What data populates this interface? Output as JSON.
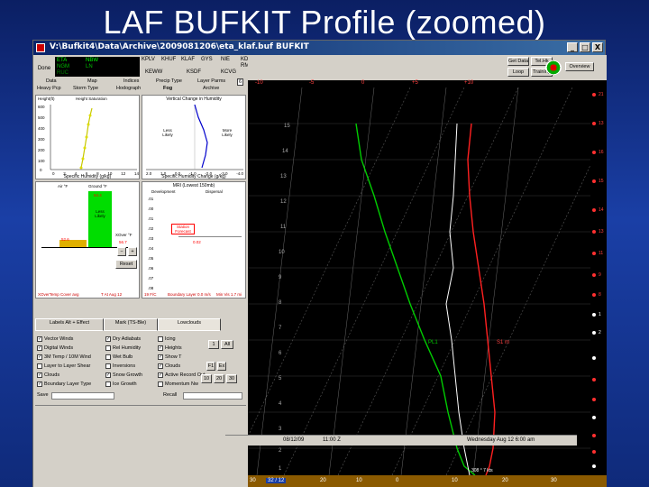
{
  "slide": {
    "title": "LAF BUFKIT Profile (zoomed)"
  },
  "window": {
    "title": "V:\\Bufkit4\\Data\\Archive\\2009081206\\eta_klaf.buf  BUFKIT",
    "buttons": [
      "_",
      "□",
      "X"
    ]
  },
  "model_panel": {
    "label": "Done",
    "models": [
      {
        "name": "ETA",
        "tag": "NBW"
      },
      {
        "name": "NGM",
        "tag": "LN"
      },
      {
        "name": "RUC",
        "tag": ""
      }
    ]
  },
  "stations": {
    "row1": [
      "KPLV",
      "KHUF",
      "KLAF",
      "GYS",
      "NIE",
      "KDAY"
    ],
    "row2": [
      "KEWW",
      "KSDF",
      "KCVG",
      "RMUN"
    ]
  },
  "menu": {
    "row1": [
      "Data",
      "Map",
      "Indices",
      "Precip Type",
      "Layer Parms"
    ],
    "row2": [
      "Heavy Pcp",
      "Storm Type",
      "Hodograph",
      "Fog",
      "Archive"
    ],
    "selected": "Fog",
    "page_number": "6"
  },
  "right_buttons": {
    "row1": [
      "Get Data",
      "Tel.Hk"
    ],
    "row2": [
      "Loop",
      "Training"
    ],
    "overview": "Overview"
  },
  "temp_axis": {
    "labels": [
      "-10",
      "-5",
      "0",
      "+5",
      "+10"
    ],
    "right_labels": [
      "21",
      "13",
      "16",
      "15",
      "14",
      "13",
      "11",
      "9",
      "8",
      "1",
      "2"
    ]
  },
  "panel_humidity": {
    "title": "Height  Saturation",
    "ylabel_top": "Height(ft)",
    "y_ticks": [
      "600",
      "500",
      "400",
      "300",
      "200",
      "100",
      "0"
    ],
    "x_ticks": [
      "0",
      "2",
      "4",
      "6",
      "8",
      "10",
      "12",
      "14"
    ],
    "xlabel": "Specific Humidity (g/kg)"
  },
  "panel_change": {
    "title": "Vertical Change in Humidity",
    "left_text": "Less Likely",
    "right_text": "More Likely",
    "x_ticks": [
      "2.0",
      "1.0",
      "0.0",
      "-1.0",
      "-2.0",
      "-3.0",
      "-4.0"
    ],
    "xlabel": "Specific Humidity Change (g/kg)"
  },
  "panel_temp": {
    "left_label": "Air °F",
    "right_label": "Ground °F",
    "box_text": "Less Likely",
    "value_left": "52.6",
    "value_green": "64.4",
    "xover_label": "XOver °F",
    "xover_value": "56.7",
    "reset": "Reset",
    "bottom_left": "XOverTemp Cover avg",
    "bottom_right": "T At Aug 12"
  },
  "panel_mix": {
    "title": "MRI (Lowest 150mb)",
    "left_head": "Development",
    "right_head": "Dispersal",
    "y_ticks": [
      ".01",
      ".00",
      ".01",
      ".02",
      ".03",
      ".04",
      ".05",
      ".06",
      ".07",
      ".08"
    ],
    "status_label": "Station Forecast",
    "value_red": "0.02",
    "footer": [
      "19 F/C",
      "Boundary Layer 0.0 m/s",
      "Min Vis 1.7 mi"
    ]
  },
  "control_tabs": [
    "Labels Alt + Effect",
    "Mark (TS-Ble)",
    "Lowclouds"
  ],
  "checkboxes_col1": [
    {
      "label": "Vector Winds",
      "checked": true
    },
    {
      "label": "Digital Winds",
      "checked": true
    },
    {
      "label": "3M Temp / 10M Wind",
      "checked": true
    },
    {
      "label": "Layer to Layer Shear",
      "checked": false
    },
    {
      "label": "Clouds",
      "checked": true
    },
    {
      "label": "Boundary Layer Type",
      "checked": true
    }
  ],
  "checkboxes_col2": [
    {
      "label": "Dry Adiabats",
      "checked": true
    },
    {
      "label": "Rel Humidity",
      "checked": false
    },
    {
      "label": "Wet Bulb",
      "checked": false
    },
    {
      "label": "Inversions",
      "checked": false
    },
    {
      "label": "Snow Growth",
      "checked": true
    },
    {
      "label": "Ice Growth",
      "checked": false
    }
  ],
  "checkboxes_col3": [
    {
      "label": "Icing",
      "checked": false
    },
    {
      "label": "Heights",
      "checked": true
    },
    {
      "label": "Show T",
      "checked": true
    },
    {
      "label": "Clouds",
      "checked": true
    },
    {
      "label": "Active Record Out",
      "checked": true
    },
    {
      "label": "Momentum Nw",
      "checked": false
    }
  ],
  "buttons_small": [
    "1",
    "All",
    "F1",
    "Ex",
    "10",
    "20",
    "30"
  ],
  "save_label": "Save",
  "recall_label": "Recall",
  "skewt": {
    "left_heights": [
      "15",
      "14",
      "13",
      "12",
      "11",
      "10",
      "9",
      "8",
      "7",
      "6",
      "5",
      "4",
      "3",
      "2",
      "1"
    ],
    "mid_label": "PL1",
    "right_mid_label": "S1 m"
  },
  "bottom_strip": {
    "left": "30",
    "frame": "32 / 12",
    "ticks": [
      "20",
      "10",
      "0",
      "10",
      "20",
      "30"
    ],
    "readout": "308 ° 7 kts"
  },
  "status_line": {
    "date": "08/12/09",
    "time": "11:00 Z",
    "valid": "Wednesday  Aug 12  6:00 am"
  }
}
